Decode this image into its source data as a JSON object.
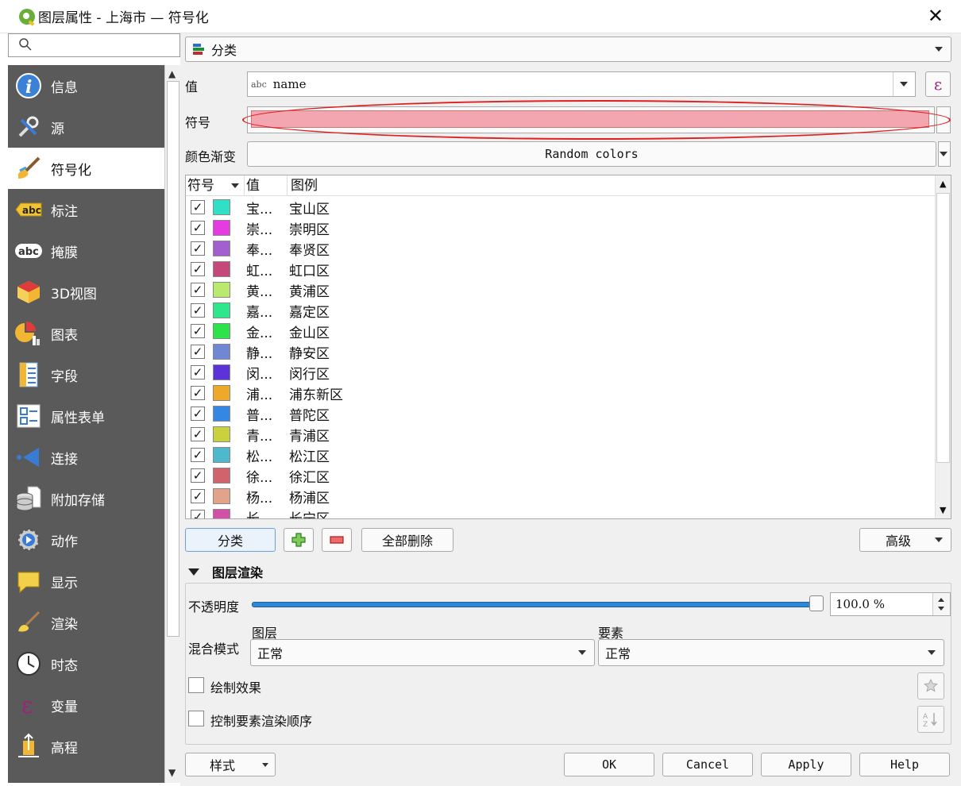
{
  "window": {
    "title": "图层属性 - 上海市 — 符号化",
    "close_glyph": "✕"
  },
  "sidebar": {
    "items": [
      {
        "label": "信息",
        "icon": "info-icon"
      },
      {
        "label": "源",
        "icon": "source-tools-icon"
      },
      {
        "label": "符号化",
        "icon": "paint-brush-icon",
        "active": true
      },
      {
        "label": "标注",
        "icon": "labels-abc-icon"
      },
      {
        "label": "掩膜",
        "icon": "mask-abc-icon"
      },
      {
        "label": "3D视图",
        "icon": "3d-cube-icon"
      },
      {
        "label": "图表",
        "icon": "diagram-icon"
      },
      {
        "label": "字段",
        "icon": "fields-icon"
      },
      {
        "label": "属性表单",
        "icon": "attribute-form-icon"
      },
      {
        "label": "连接",
        "icon": "joins-icon"
      },
      {
        "label": "附加存储",
        "icon": "auxiliary-storage-icon"
      },
      {
        "label": "动作",
        "icon": "actions-icon"
      },
      {
        "label": "显示",
        "icon": "display-icon"
      },
      {
        "label": "渲染",
        "icon": "rendering-icon"
      },
      {
        "label": "时态",
        "icon": "temporal-clock-icon"
      },
      {
        "label": "变量",
        "icon": "variables-epsilon-icon"
      },
      {
        "label": "高程",
        "icon": "elevation-icon"
      }
    ]
  },
  "renderer": {
    "type_label": "分类"
  },
  "form": {
    "value_label": "值",
    "value_type": "abc",
    "value_field": "name",
    "expression_glyph": "ε",
    "symbol_label": "符号",
    "ramp_label": "颜色渐变",
    "ramp_value": "Random colors"
  },
  "table": {
    "headers": [
      "符号",
      "值",
      "图例"
    ],
    "rows": [
      {
        "value": "宝...",
        "legend": "宝山区",
        "color": "#2fe0c7"
      },
      {
        "value": "崇...",
        "legend": "崇明区",
        "color": "#e63ae3"
      },
      {
        "value": "奉...",
        "legend": "奉贤区",
        "color": "#a35fd0"
      },
      {
        "value": "虹...",
        "legend": "虹口区",
        "color": "#c6477a"
      },
      {
        "value": "黄...",
        "legend": "黄浦区",
        "color": "#b9ea6d"
      },
      {
        "value": "嘉...",
        "legend": "嘉定区",
        "color": "#2ee68b"
      },
      {
        "value": "金...",
        "legend": "金山区",
        "color": "#2ee34a"
      },
      {
        "value": "静...",
        "legend": "静安区",
        "color": "#7087d6"
      },
      {
        "value": "闵...",
        "legend": "闵行区",
        "color": "#5b33d8"
      },
      {
        "value": "浦...",
        "legend": "浦东新区",
        "color": "#eea92a"
      },
      {
        "value": "普...",
        "legend": "普陀区",
        "color": "#3587e4"
      },
      {
        "value": "青...",
        "legend": "青浦区",
        "color": "#c9d23e"
      },
      {
        "value": "松...",
        "legend": "松江区",
        "color": "#4eb9cc"
      },
      {
        "value": "徐...",
        "legend": "徐汇区",
        "color": "#d0636b"
      },
      {
        "value": "杨...",
        "legend": "杨浦区",
        "color": "#e1a48a"
      },
      {
        "value": "长...",
        "legend": "长宁区",
        "color": "#d34fa8"
      }
    ],
    "check_glyph": "✓"
  },
  "actions": {
    "classify": "分类",
    "delete_all": "全部删除",
    "advanced": "高级"
  },
  "layer_rendering": {
    "title": "图层渲染",
    "opacity_label": "不透明度",
    "opacity_value": "100.0 %",
    "opacity": 1.0,
    "blend_label": "混合模式",
    "layer_label": "图层",
    "layer_blend": "正常",
    "feature_label": "要素",
    "feature_blend": "正常",
    "draw_effects": "绘制效果",
    "control_order": "控制要素渲染顺序"
  },
  "footer": {
    "style": "样式",
    "ok": "OK",
    "cancel": "Cancel",
    "apply": "Apply",
    "help": "Help"
  }
}
